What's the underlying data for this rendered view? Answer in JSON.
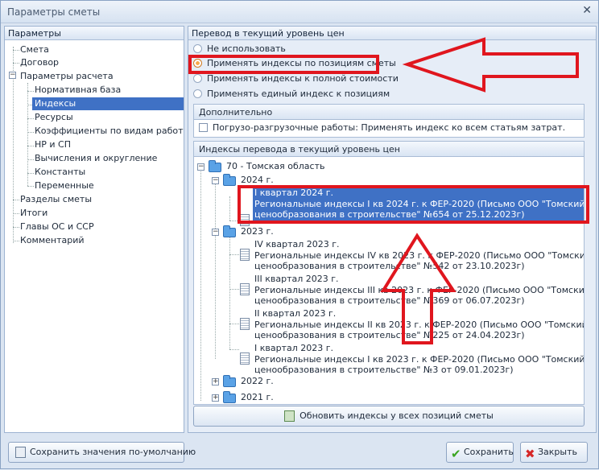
{
  "window": {
    "title": "Параметры сметы",
    "close": "✕"
  },
  "left_panel": {
    "header": "Параметры",
    "items": [
      {
        "label": "Смета",
        "level": 1
      },
      {
        "label": "Договор",
        "level": 1
      },
      {
        "label": "Параметры расчета",
        "level": 1
      },
      {
        "label": "Нормативная база",
        "level": 2
      },
      {
        "label": "Индексы",
        "level": 2
      },
      {
        "label": "Ресурсы",
        "level": 2
      },
      {
        "label": "Коэффициенты по видам работ",
        "level": 2
      },
      {
        "label": "НР и СП",
        "level": 2
      },
      {
        "label": "Вычисления и округление",
        "level": 2
      },
      {
        "label": "Константы",
        "level": 2
      },
      {
        "label": "Переменные",
        "level": 2
      },
      {
        "label": "Разделы сметы",
        "level": 1
      },
      {
        "label": "Итоги",
        "level": 1
      },
      {
        "label": "Главы ОС и ССР",
        "level": 1
      },
      {
        "label": "Комментарий",
        "level": 1
      }
    ]
  },
  "right_panel": {
    "header": "Перевод в текущий уровень цен",
    "options": [
      {
        "label": "Не использовать"
      },
      {
        "label": "Применять индексы по позициям сметы"
      },
      {
        "label": "Применять индексы к полной стоимости"
      },
      {
        "label": "Применять единый индекс к позициям"
      }
    ],
    "extra_header": "Дополнительно",
    "extra_checkbox": "Погрузо-разгрузочные работы: Применять индекс ко всем статьям затрат.",
    "index_header": "Индексы перевода в текущий уровень цен",
    "tree": {
      "region": "70 - Томская область",
      "y2024": "2024 г.",
      "q1_2024_title": "I квартал 2024 г.",
      "q1_2024_l1": "Региональные индексы I кв 2024 г. к ФЕР-2020 (Письмо ООО \"Томский центр",
      "q1_2024_l2": "ценообразования в строительстве\" №654 от 25.12.2023г)",
      "y2023": "2023 г.",
      "q4_title": "IV квартал 2023 г.",
      "q4_l1": "Региональные индексы IV кв 2023 г. к ФЕР-2020 (Письмо ООО \"Томский центр",
      "q4_l2": "ценообразования в строительстве\" №542 от 23.10.2023г)",
      "q3_title": "III квартал 2023 г.",
      "q3_l1": "Региональные индексы III кв 2023 г. к ФЕР-2020 (Письмо ООО \"Томский центр",
      "q3_l2": "ценообразования в строительстве\" №369 от 06.07.2023г)",
      "q2_title": "II квартал 2023 г.",
      "q2_l1": "Региональные индексы II кв 2023 г. к ФЕР-2020 (Письмо ООО \"Томский центр",
      "q2_l2": "ценообразования в строительстве\" №225 от 24.04.2023г)",
      "q1_title": "I квартал 2023 г.",
      "q1_l1": "Региональные индексы I кв 2023 г. к ФЕР-2020 (Письмо ООО \"Томский центр",
      "q1_l2": "ценообразования в строительстве\" №3 от 09.01.2023г)",
      "y2022": "2022 г.",
      "y2021": "2021 г."
    },
    "update_button": "Обновить индексы у всех позиций сметы"
  },
  "footer": {
    "save_default": "Сохранить значения по-умолчанию",
    "save": "Сохранить",
    "close": "Закрыть"
  },
  "colors": {
    "selection": "#3f71c5",
    "annotation": "#e0161e"
  }
}
